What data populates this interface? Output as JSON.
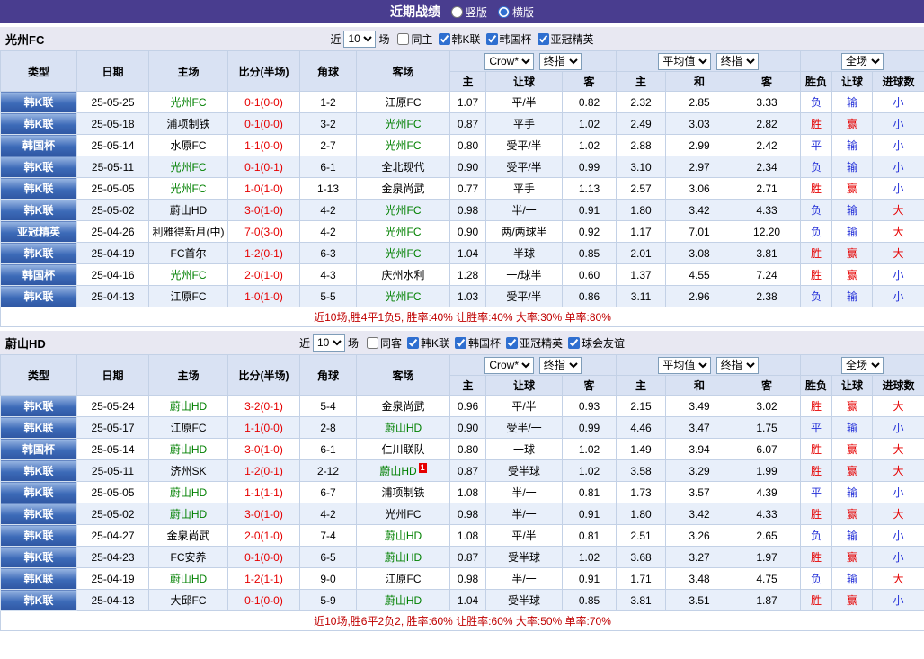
{
  "topbar": {
    "title": "近期战绩",
    "options": [
      {
        "label": "竖版",
        "checked": false
      },
      {
        "label": "横版",
        "checked": true
      }
    ]
  },
  "sections": [
    {
      "team": "光州FC",
      "filter": {
        "prefix": "近",
        "count": "10",
        "suffix": "场",
        "checkboxes": [
          {
            "label": "同主",
            "checked": false
          },
          {
            "label": "韩K联",
            "checked": true
          },
          {
            "label": "韩国杯",
            "checked": true
          },
          {
            "label": "亚冠精英",
            "checked": true
          }
        ]
      },
      "header": {
        "cols": [
          "类型",
          "日期",
          "主场",
          "比分(半场)",
          "角球",
          "客场"
        ],
        "book_select": "Crow*",
        "stage_select": "终指",
        "avg_select": "平均值",
        "avg_stage_select": "终指",
        "scope_select": "全场",
        "sub": [
          "主",
          "让球",
          "客",
          "主",
          "和",
          "客",
          "胜负",
          "让球",
          "进球数"
        ]
      },
      "rows": [
        {
          "type": "韩K联",
          "date": "25-05-25",
          "home": "光州FC",
          "score": "0-1(0-0)",
          "corner": "1-2",
          "away": "江原FC",
          "o1": "1.07",
          "o2": "平/半",
          "o3": "0.82",
          "a1": "2.32",
          "a2": "2.85",
          "a3": "3.33",
          "r1": "负",
          "r2": "输",
          "r3": "小"
        },
        {
          "type": "韩K联",
          "date": "25-05-18",
          "home": "浦项制铁",
          "score": "0-1(0-0)",
          "corner": "3-2",
          "away": "光州FC",
          "o1": "0.87",
          "o2": "平手",
          "o3": "1.02",
          "a1": "2.49",
          "a2": "3.03",
          "a3": "2.82",
          "r1": "胜",
          "r2": "赢",
          "r3": "小"
        },
        {
          "type": "韩国杯",
          "date": "25-05-14",
          "home": "水原FC",
          "score": "1-1(0-0)",
          "corner": "2-7",
          "away": "光州FC",
          "o1": "0.80",
          "o2": "受平/半",
          "o3": "1.02",
          "a1": "2.88",
          "a2": "2.99",
          "a3": "2.42",
          "r1": "平",
          "r2": "输",
          "r3": "小"
        },
        {
          "type": "韩K联",
          "date": "25-05-11",
          "home": "光州FC",
          "score": "0-1(0-1)",
          "corner": "6-1",
          "away": "全北现代",
          "o1": "0.90",
          "o2": "受平/半",
          "o3": "0.99",
          "a1": "3.10",
          "a2": "2.97",
          "a3": "2.34",
          "r1": "负",
          "r2": "输",
          "r3": "小"
        },
        {
          "type": "韩K联",
          "date": "25-05-05",
          "home": "光州FC",
          "score": "1-0(1-0)",
          "corner": "1-13",
          "away": "金泉尚武",
          "o1": "0.77",
          "o2": "平手",
          "o3": "1.13",
          "a1": "2.57",
          "a2": "3.06",
          "a3": "2.71",
          "r1": "胜",
          "r2": "赢",
          "r3": "小"
        },
        {
          "type": "韩K联",
          "date": "25-05-02",
          "home": "蔚山HD",
          "score": "3-0(1-0)",
          "corner": "4-2",
          "away": "光州FC",
          "o1": "0.98",
          "o2": "半/一",
          "o3": "0.91",
          "a1": "1.80",
          "a2": "3.42",
          "a3": "4.33",
          "r1": "负",
          "r2": "输",
          "r3": "大"
        },
        {
          "type": "亚冠精英",
          "date": "25-04-26",
          "home": "利雅得新月(中)",
          "score": "7-0(3-0)",
          "corner": "4-2",
          "away": "光州FC",
          "o1": "0.90",
          "o2": "两/两球半",
          "o3": "0.92",
          "a1": "1.17",
          "a2": "7.01",
          "a3": "12.20",
          "r1": "负",
          "r2": "输",
          "r3": "大"
        },
        {
          "type": "韩K联",
          "date": "25-04-19",
          "home": "FC首尔",
          "score": "1-2(0-1)",
          "corner": "6-3",
          "away": "光州FC",
          "o1": "1.04",
          "o2": "半球",
          "o3": "0.85",
          "a1": "2.01",
          "a2": "3.08",
          "a3": "3.81",
          "r1": "胜",
          "r2": "赢",
          "r3": "大"
        },
        {
          "type": "韩国杯",
          "date": "25-04-16",
          "home": "光州FC",
          "score": "2-0(1-0)",
          "corner": "4-3",
          "away": "庆州水利",
          "o1": "1.28",
          "o2": "一/球半",
          "o3": "0.60",
          "a1": "1.37",
          "a2": "4.55",
          "a3": "7.24",
          "r1": "胜",
          "r2": "赢",
          "r3": "小"
        },
        {
          "type": "韩K联",
          "date": "25-04-13",
          "home": "江原FC",
          "score": "1-0(1-0)",
          "corner": "5-5",
          "away": "光州FC",
          "o1": "1.03",
          "o2": "受平/半",
          "o3": "0.86",
          "a1": "3.11",
          "a2": "2.96",
          "a3": "2.38",
          "r1": "负",
          "r2": "输",
          "r3": "小"
        }
      ],
      "summary": "近10场,胜4平1负5, 胜率:40% 让胜率:40% 大率:30% 单率:80%"
    },
    {
      "team": "蔚山HD",
      "filter": {
        "prefix": "近",
        "count": "10",
        "suffix": "场",
        "checkboxes": [
          {
            "label": "同客",
            "checked": false
          },
          {
            "label": "韩K联",
            "checked": true
          },
          {
            "label": "韩国杯",
            "checked": true
          },
          {
            "label": "亚冠精英",
            "checked": true
          },
          {
            "label": "球会友谊",
            "checked": true
          }
        ]
      },
      "header": {
        "cols": [
          "类型",
          "日期",
          "主场",
          "比分(半场)",
          "角球",
          "客场"
        ],
        "book_select": "Crow*",
        "stage_select": "终指",
        "avg_select": "平均值",
        "avg_stage_select": "终指",
        "scope_select": "全场",
        "sub": [
          "主",
          "让球",
          "客",
          "主",
          "和",
          "客",
          "胜负",
          "让球",
          "进球数"
        ]
      },
      "rows": [
        {
          "type": "韩K联",
          "date": "25-05-24",
          "home": "蔚山HD",
          "score": "3-2(0-1)",
          "corner": "5-4",
          "away": "金泉尚武",
          "o1": "0.96",
          "o2": "平/半",
          "o3": "0.93",
          "a1": "2.15",
          "a2": "3.49",
          "a3": "3.02",
          "r1": "胜",
          "r2": "赢",
          "r3": "大"
        },
        {
          "type": "韩K联",
          "date": "25-05-17",
          "home": "江原FC",
          "score": "1-1(0-0)",
          "corner": "2-8",
          "away": "蔚山HD",
          "o1": "0.90",
          "o2": "受半/一",
          "o3": "0.99",
          "a1": "4.46",
          "a2": "3.47",
          "a3": "1.75",
          "r1": "平",
          "r2": "输",
          "r3": "小"
        },
        {
          "type": "韩国杯",
          "date": "25-05-14",
          "home": "蔚山HD",
          "score": "3-0(1-0)",
          "corner": "6-1",
          "away": "仁川联队",
          "o1": "0.80",
          "o2": "一球",
          "o3": "1.02",
          "a1": "1.49",
          "a2": "3.94",
          "a3": "6.07",
          "r1": "胜",
          "r2": "赢",
          "r3": "大"
        },
        {
          "type": "韩K联",
          "date": "25-05-11",
          "home": "济州SK",
          "score": "1-2(0-1)",
          "corner": "2-12",
          "away": "蔚山HD",
          "away_badge": "1",
          "o1": "0.87",
          "o2": "受半球",
          "o3": "1.02",
          "a1": "3.58",
          "a2": "3.29",
          "a3": "1.99",
          "r1": "胜",
          "r2": "赢",
          "r3": "大"
        },
        {
          "type": "韩K联",
          "date": "25-05-05",
          "home": "蔚山HD",
          "score": "1-1(1-1)",
          "corner": "6-7",
          "away": "浦项制铁",
          "o1": "1.08",
          "o2": "半/一",
          "o3": "0.81",
          "a1": "1.73",
          "a2": "3.57",
          "a3": "4.39",
          "r1": "平",
          "r2": "输",
          "r3": "小"
        },
        {
          "type": "韩K联",
          "date": "25-05-02",
          "home": "蔚山HD",
          "score": "3-0(1-0)",
          "corner": "4-2",
          "away": "光州FC",
          "o1": "0.98",
          "o2": "半/一",
          "o3": "0.91",
          "a1": "1.80",
          "a2": "3.42",
          "a3": "4.33",
          "r1": "胜",
          "r2": "赢",
          "r3": "大"
        },
        {
          "type": "韩K联",
          "date": "25-04-27",
          "home": "金泉尚武",
          "score": "2-0(1-0)",
          "corner": "7-4",
          "away": "蔚山HD",
          "o1": "1.08",
          "o2": "平/半",
          "o3": "0.81",
          "a1": "2.51",
          "a2": "3.26",
          "a3": "2.65",
          "r1": "负",
          "r2": "输",
          "r3": "小"
        },
        {
          "type": "韩K联",
          "date": "25-04-23",
          "home": "FC安养",
          "score": "0-1(0-0)",
          "corner": "6-5",
          "away": "蔚山HD",
          "o1": "0.87",
          "o2": "受半球",
          "o3": "1.02",
          "a1": "3.68",
          "a2": "3.27",
          "a3": "1.97",
          "r1": "胜",
          "r2": "赢",
          "r3": "小"
        },
        {
          "type": "韩K联",
          "date": "25-04-19",
          "home": "蔚山HD",
          "score": "1-2(1-1)",
          "corner": "9-0",
          "away": "江原FC",
          "o1": "0.98",
          "o2": "半/一",
          "o3": "0.91",
          "a1": "1.71",
          "a2": "3.48",
          "a3": "4.75",
          "r1": "负",
          "r2": "输",
          "r3": "大"
        },
        {
          "type": "韩K联",
          "date": "25-04-13",
          "home": "大邱FC",
          "score": "0-1(0-0)",
          "corner": "5-9",
          "away": "蔚山HD",
          "o1": "1.04",
          "o2": "受半球",
          "o3": "0.85",
          "a1": "3.81",
          "a2": "3.51",
          "a3": "1.87",
          "r1": "胜",
          "r2": "赢",
          "r3": "小"
        }
      ],
      "summary": "近10场,胜6平2负2, 胜率:60% 让胜率:60% 大率:50% 单率:70%"
    }
  ]
}
